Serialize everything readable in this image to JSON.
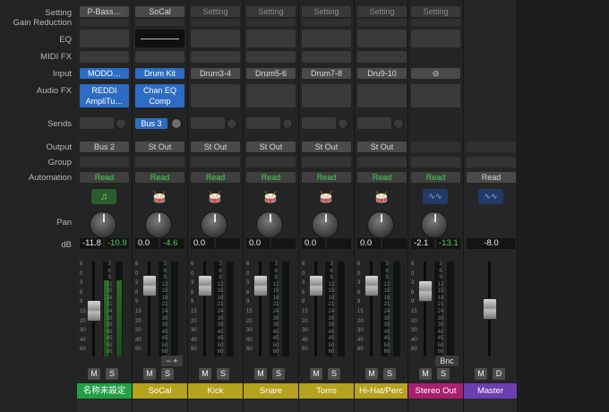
{
  "row_labels": [
    "Setting",
    "Gain Reduction",
    "EQ",
    "MIDI FX",
    "Input",
    "Audio FX",
    "Sends",
    "Output",
    "Group",
    "Automation",
    "Pan",
    "dB"
  ],
  "channels": [
    {
      "setting": "P-Bass…",
      "input": "MODO…",
      "input_active": true,
      "fx": [
        "REDDI",
        "AmpliTu…"
      ],
      "send": "",
      "output": "Bus 2",
      "automation": "Read",
      "icon": "note-icon",
      "db": "-11.8",
      "peak": "-10.9",
      "name": "名称未設定",
      "color": "#22a046",
      "fader_level": 0.52,
      "meter_level": 0.8
    },
    {
      "setting": "SoCal",
      "input": "Drum Kit",
      "input_active": true,
      "fx": [
        "Chan EQ",
        "Comp"
      ],
      "send": "Bus 3",
      "output": "St Out",
      "automation": "Read",
      "icon": "drum-icon",
      "db": "0.0",
      "peak": "-4.6",
      "name": "SoCal",
      "color": "#b5a21e",
      "fader_level": 0.18,
      "meter_level": 0.0
    },
    {
      "setting": "Setting",
      "input": "Drum3-4",
      "input_active": false,
      "fx": [],
      "send": "",
      "output": "St Out",
      "automation": "Read",
      "icon": "drum-icon",
      "db": "0.0",
      "peak": "",
      "name": "Kick",
      "color": "#b5a21e",
      "fader_level": 0.18,
      "meter_level": 0.0
    },
    {
      "setting": "Setting",
      "input": "Drum5-6",
      "input_active": false,
      "fx": [],
      "send": "",
      "output": "St Out",
      "automation": "Read",
      "icon": "drum-icon",
      "db": "0.0",
      "peak": "",
      "name": "Snare",
      "color": "#b5a21e",
      "fader_level": 0.18,
      "meter_level": 0.0
    },
    {
      "setting": "Setting",
      "input": "Drum7-8",
      "input_active": false,
      "fx": [],
      "send": "",
      "output": "St Out",
      "automation": "Read",
      "icon": "drum-icon",
      "db": "0.0",
      "peak": "",
      "name": "Toms",
      "color": "#b5a21e",
      "fader_level": 0.18,
      "meter_level": 0.0
    },
    {
      "setting": "Setting",
      "input": "Dru9-10",
      "input_active": false,
      "fx": [],
      "send": "",
      "output": "St Out",
      "automation": "Read",
      "icon": "drum-icon",
      "db": "0.0",
      "peak": "",
      "name": "Hi-Hat/Perc",
      "color": "#b5a21e",
      "fader_level": 0.18,
      "meter_level": 0.0
    },
    {
      "setting": "Setting",
      "input": "link-icon",
      "input_active": false,
      "fx": [],
      "send": "",
      "output": "",
      "automation": "Read",
      "icon": "waveform-icon",
      "db": "-2.1",
      "peak": "-13.1",
      "name": "Stereo Out",
      "color": "#a8206f",
      "fader_level": 0.25,
      "meter_level": 0.0
    },
    {
      "setting": "",
      "input": "",
      "input_active": false,
      "fx": [],
      "send": "",
      "output": "",
      "automation": "Read",
      "icon": "waveform-icon",
      "db": "-8.0",
      "peak": "",
      "name": "Master",
      "color": "#6b3fb0",
      "fader_level": 0.5,
      "meter_level": 0.0
    }
  ],
  "scale_left": [
    "6",
    "0",
    "3",
    "6",
    "9",
    "15",
    "20",
    "30",
    "40",
    "60"
  ],
  "scale_meter": [
    "3",
    "6",
    "9",
    "12",
    "15",
    "18",
    "21",
    "24",
    "30",
    "35",
    "40",
    "45",
    "50",
    "60"
  ],
  "controls": {
    "add_remove": "− +",
    "bounce": "Bnc",
    "mute": "M",
    "solo": "S",
    "dim": "D"
  }
}
